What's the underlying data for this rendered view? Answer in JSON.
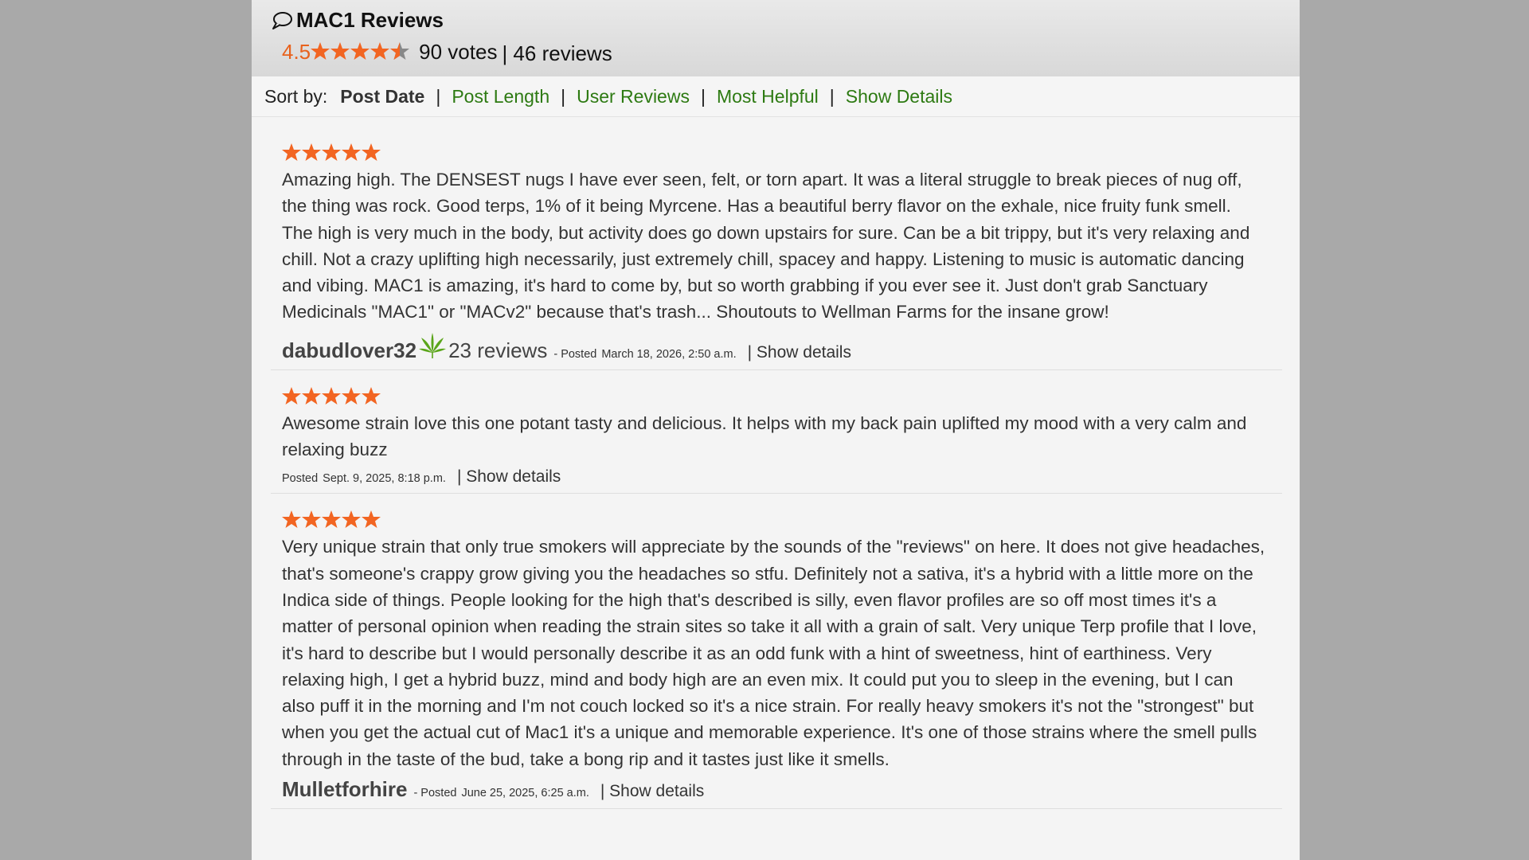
{
  "header": {
    "title": "MAC1 Reviews",
    "rating": "4.5",
    "votes": "90 votes",
    "reviews": "| 46 reviews"
  },
  "sort": {
    "label": "Sort by:",
    "active": "Post Date",
    "options": [
      "Post Length",
      "User Reviews",
      "Most Helpful",
      "Show Details"
    ]
  },
  "reviews": [
    {
      "stars": 5,
      "text": "Amazing high. The DENSEST nugs I have ever seen, felt, or torn apart. It was a literal struggle to break pieces of nug off, the thing was rock. Good terps, 1% of it being Myrcene. Has a beautiful berry flavor on the exhale, nice fruity funk smell. The high is very much in the body, but activity does go down upstairs for sure. Can be a bit trippy, but it's very relaxing and chill. Not a crazy uplifting high necessarily, just extremely chill, spacey and happy. Listening to music is automatic dancing and vibing. MAC1 is amazing, it's hard to come by, but so worth grabbing if you ever see it. Just don't grab Sanctuary Medicinals \"MAC1\" or \"MACv2\" because that's trash... Shoutouts to Wellman Farms for the insane grow!",
      "user": "dabudlover32",
      "user_reviews": "23 reviews",
      "posted": "- Posted",
      "date": "March 18, 2026, 2:50 a.m.",
      "show_details": "| Show details"
    },
    {
      "stars": 5,
      "text": "Awesome strain love this one potant tasty and delicious. It helps with my back pain uplifted my mood with a very calm and relaxing buzz",
      "user": "",
      "user_reviews": "",
      "posted": "Posted",
      "date": "Sept. 9, 2025, 8:18 p.m.",
      "show_details": "| Show details"
    },
    {
      "stars": 5,
      "text": "Very unique strain that only true smokers will appreciate by the sounds of the \"reviews\" on here. It does not give headaches, that's someone's crappy grow giving you the headaches so stfu. Definitely not a sativa, it's a hybrid with a little more on the Indica side of things. People looking for the high that's described is silly, even flavor profiles are so off most times it's a matter of personal opinion when reading the strain sites so take it all with a grain of salt. Very unique Terp profile that I love, it's hard to describe but I would personally describe it as an odd funk with a hint of sweetness, hint of earthiness. Very relaxing high, I get a hybrid buzz, mind and body high are an even mix. It could put you to sleep in the evening, but I can also puff it in the morning and I'm not couch locked so it's a nice strain. For really heavy smokers it's not the \"strongest\" but when you get the actual cut of Mac1 it's a unique and memorable experience. It's one of those strains where the smell pulls through in the taste of the bud, take a bong rip and it tastes just like it smells.",
      "user": "Mulletforhire",
      "user_reviews": "",
      "posted": "- Posted",
      "date": "June 25, 2025, 6:25 a.m.",
      "show_details": "| Show details"
    }
  ],
  "colors": {
    "star": "#f26522",
    "star_gray": "#888888",
    "link": "#2d7a12",
    "rating": "#e8621d"
  },
  "icons": {
    "title": "speech-bubble-icon",
    "user_badge": "cannabis-leaf-icon",
    "star": "star-icon"
  }
}
